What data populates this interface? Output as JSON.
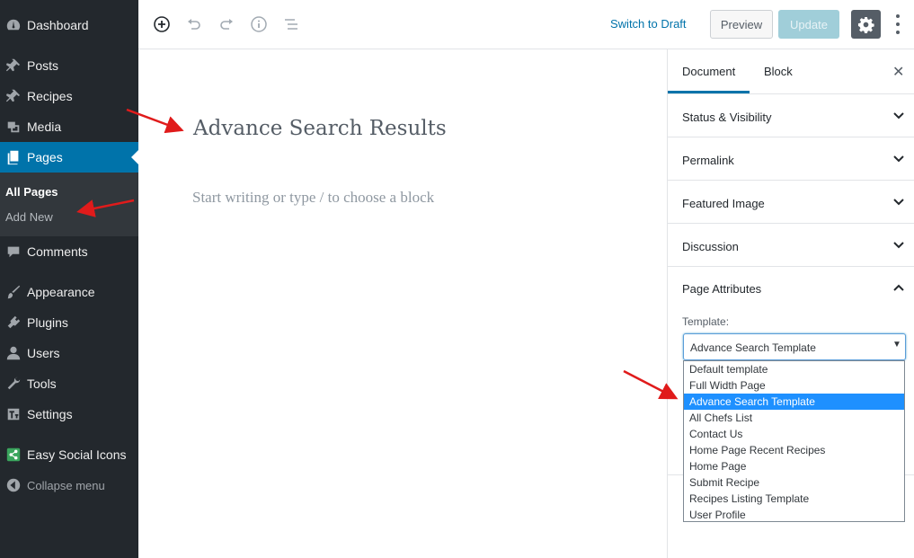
{
  "sidebar": {
    "items": [
      {
        "label": "Dashboard",
        "icon": "dashboard-icon"
      },
      {
        "label": "Posts",
        "icon": "pin-icon"
      },
      {
        "label": "Recipes",
        "icon": "pin-icon"
      },
      {
        "label": "Media",
        "icon": "media-icon"
      },
      {
        "label": "Pages",
        "icon": "pages-icon"
      },
      {
        "label": "Comments",
        "icon": "comment-icon"
      },
      {
        "label": "Appearance",
        "icon": "brush-icon"
      },
      {
        "label": "Plugins",
        "icon": "plugin-icon"
      },
      {
        "label": "Users",
        "icon": "user-icon"
      },
      {
        "label": "Tools",
        "icon": "wrench-icon"
      },
      {
        "label": "Settings",
        "icon": "settings-icon"
      },
      {
        "label": "Easy Social Icons",
        "icon": "share-icon"
      },
      {
        "label": "Collapse menu",
        "icon": "collapse-icon"
      }
    ],
    "submenu": {
      "all_pages": "All Pages",
      "add_new": "Add New"
    }
  },
  "toolbar": {
    "switch_to_draft": "Switch to Draft",
    "preview": "Preview",
    "update": "Update",
    "icons": [
      "add-block-icon",
      "undo-icon",
      "redo-icon",
      "info-icon",
      "outline-icon",
      "gear-icon",
      "more-icon"
    ]
  },
  "editor": {
    "title": "Advance Search Results",
    "placeholder": "Start writing or type / to choose a block"
  },
  "panel": {
    "tabs": [
      "Document",
      "Block"
    ],
    "sections": [
      "Status & Visibility",
      "Permalink",
      "Featured Image",
      "Discussion"
    ],
    "page_attributes": "Page Attributes",
    "template_label": "Template:",
    "template_value": "Advance Search Template",
    "template_options": [
      "Default template",
      "Full Width Page",
      "Advance Search Template",
      "All Chefs List",
      "Contact Us",
      "Home Page Recent Recipes",
      "Home Page",
      "Submit Recipe",
      "Recipes Listing Template",
      "User Profile"
    ],
    "selected_option": "Advance Search Template"
  },
  "colors": {
    "sidebar_bg": "#23282d",
    "active_menu": "#0073aa",
    "highlight_option": "#1e90ff",
    "annotation_arrow": "#e01b1b"
  }
}
